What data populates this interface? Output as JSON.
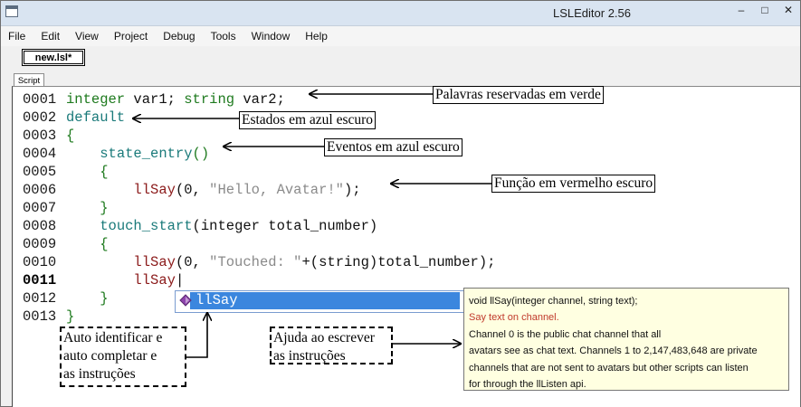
{
  "window": {
    "title": "LSLEditor 2.56",
    "buttons": [
      "–",
      "□",
      "✕"
    ]
  },
  "menu": [
    "File",
    "Edit",
    "View",
    "Project",
    "Debug",
    "Tools",
    "Window",
    "Help"
  ],
  "tabs": {
    "document_tab": "new.lsl*",
    "script_tab": "Script"
  },
  "code": {
    "line_numbers": [
      "0001",
      "0002",
      "0003",
      "0004",
      "0005",
      "0006",
      "0007",
      "0008",
      "0009",
      "0010",
      "0011",
      "0012",
      "0013"
    ],
    "line1": {
      "kw1": "integer",
      "t1": " var1; ",
      "kw2": "string",
      "t2": " var2;"
    },
    "line2": {
      "state": "default"
    },
    "line3": {
      "brace": "{"
    },
    "line4": {
      "event": "state_entry",
      "parens": "()"
    },
    "line5": {
      "brace": "{"
    },
    "line6": {
      "fn": "llSay",
      "open": "(0, ",
      "str": "\"Hello, Avatar!\"",
      "close": ");"
    },
    "line7": {
      "brace": "}"
    },
    "line8": {
      "event": "touch_start",
      "open": "(",
      "kw": "integer",
      "rest": " total_number",
      "close": ")"
    },
    "line9": {
      "brace": "{"
    },
    "line10": {
      "fn": "llSay",
      "open": "(0, ",
      "str": "\"Touched: \"",
      "plus": "+(",
      "kw": "string",
      "rest": ")total_number);"
    },
    "line11": {
      "fn": "llSay"
    },
    "line12": {
      "brace": "}"
    },
    "line13": {
      "brace": "}"
    }
  },
  "autocomplete": {
    "item": "llSay",
    "icon": "function-method-icon"
  },
  "tooltip": {
    "signature": "void llSay(integer channel, string text);",
    "summary": "Say text on channel.",
    "line1": "Channel 0 is the public chat channel that all",
    "line2": "avatars see as chat text. Channels 1 to 2,147,483,648 are private",
    "line3": "channels that are not sent to avatars but other scripts can listen",
    "line4": "for through the llListen api."
  },
  "annotations": {
    "reserved_words": "Palavras reservadas em verde",
    "states": "Estados em azul escuro",
    "events": "Eventos em azul escuro",
    "functions": "Função em vermelho escuro",
    "autocomplete_l1": "Auto identificar e",
    "autocomplete_l2": "auto completar e",
    "autocomplete_l3": "as instruções",
    "help_l1": "Ajuda ao escrever",
    "help_l2": "as instruções"
  },
  "colors": {
    "reserved_word": "#1e7a1e",
    "state_event": "#1a7a7a",
    "function": "#8b1a1a",
    "string": "#8a8a8a",
    "autocomplete_selection": "#3b86de",
    "tooltip_background": "#ffffe1",
    "tooltip_summary": "#c0392b"
  }
}
